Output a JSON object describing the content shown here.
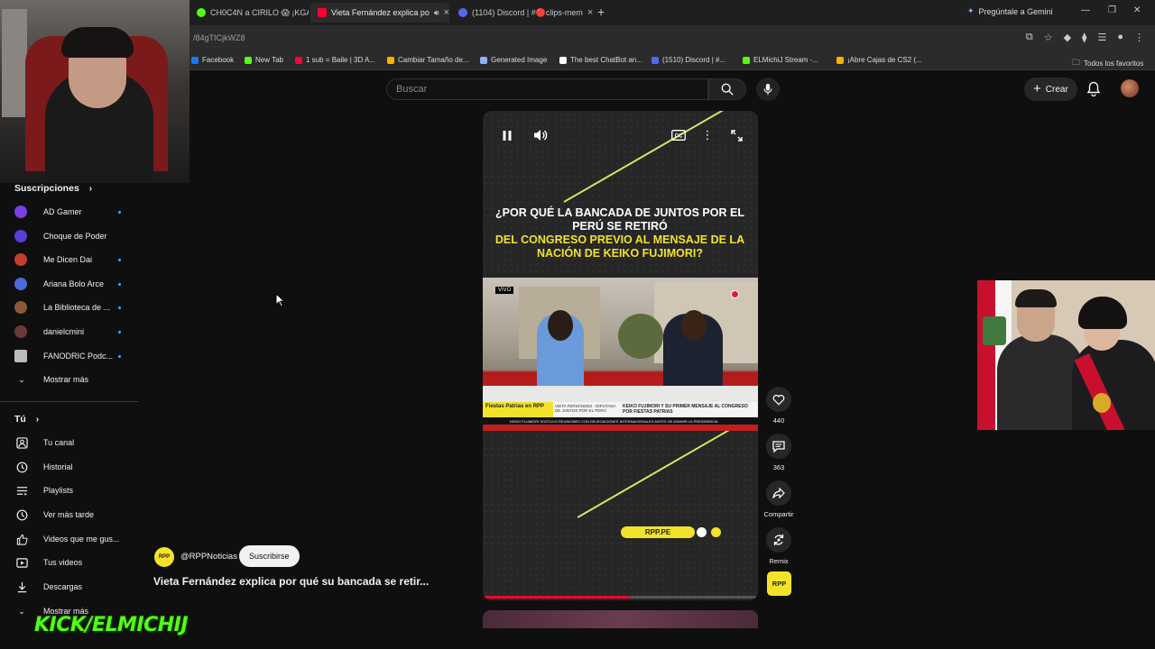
{
  "browser": {
    "tabs": [
      {
        "label": "CH0C4N a CIRILO 😱 ¡KGAI",
        "color": "#53fc18"
      },
      {
        "label": "Vieta Fernández explica po",
        "color": "#ff0033"
      },
      {
        "label": "(1104) Discord | #🔴clips-mem",
        "color": "#5865f2"
      }
    ],
    "gemini_label": "Pregúntale a Gemini",
    "url": "/84gTICjkWZ8",
    "bookmarks": [
      {
        "label": "Facebook",
        "color": "#1877f2"
      },
      {
        "label": "New Tab",
        "color": "#53fc18"
      },
      {
        "label": "1 sub = Baile | 3D A...",
        "color": "#ff0033"
      },
      {
        "label": "Cambiar Tamaño de...",
        "color": "#f4b400"
      },
      {
        "label": "Generated Image",
        "color": "#8ab4f8"
      },
      {
        "label": "The best ChatBot an...",
        "color": "#ffffff"
      },
      {
        "label": "(1510) Discord | #...",
        "color": "#5865f2"
      },
      {
        "label": "ELMichiJ Stream -...",
        "color": "#53fc18"
      },
      {
        "label": "¡Abre Cajas de CS2 (...",
        "color": "#f4b400"
      }
    ],
    "all_bookmarks": "Todos los favoritos"
  },
  "header": {
    "search_placeholder": "Buscar",
    "create_label": "Crear"
  },
  "sidebar": {
    "subscriptions_title": "Suscripciones",
    "subscriptions": [
      {
        "name": "AD Gamer",
        "color": "#7b3fe4",
        "dot": true
      },
      {
        "name": "Choque de Poder",
        "color": "#5a3fd4",
        "dot": false
      },
      {
        "name": "Me Dicen Dai",
        "color": "#c43d2a",
        "dot": true
      },
      {
        "name": "Ariana Bolo Arce",
        "color": "#4a6ad9",
        "dot": true
      },
      {
        "name": "La Biblioteca de ...",
        "color": "#8a5a3a",
        "dot": true
      },
      {
        "name": "danielcmini",
        "color": "#6a3a3a",
        "dot": true
      },
      {
        "name": "FANODRIC Podc...",
        "color": "#bbbbbb",
        "dot": true
      }
    ],
    "show_more": "Mostrar más",
    "you_title": "Tú",
    "you_items": [
      {
        "label": "Tu canal",
        "icon": "channel-icon"
      },
      {
        "label": "Historial",
        "icon": "history-icon"
      },
      {
        "label": "Playlists",
        "icon": "playlists-icon"
      },
      {
        "label": "Ver más tarde",
        "icon": "watch-later-icon"
      },
      {
        "label": "Videos que me gus...",
        "icon": "liked-icon"
      },
      {
        "label": "Tus videos",
        "icon": "your-videos-icon"
      },
      {
        "label": "Descargas",
        "icon": "downloads-icon"
      },
      {
        "label": "Mostrar más",
        "icon": "chevron-down-icon"
      }
    ]
  },
  "overlay": {
    "kick_text": "KICK/ELMICHIJ"
  },
  "short": {
    "headline_white": "¿Por qué la bancada de Juntos por el Perú se retiró",
    "headline_yellow": "del Congreso previo al mensaje de la Nación de Keiko Fujimori?",
    "live_tag": "VIVO",
    "lower_third": {
      "program": "Fiestas Patrias en RPP",
      "guest": "VIETA FERNÁNDEZ · DIPUTADA DE JUNTOS POR EL PERÚ",
      "headline": "KEIKO FUJIMORI Y SU PRIMER MENSAJE AL CONGRESO POR FIESTAS PATRIAS",
      "ticker": "KEIKO FUJIMORI SOSTUVO REUNIONES CON DELEGACIONES INTERNACIONALES ANTES DE ASUMIR LA PRESIDENCIA"
    },
    "brand_pill": "RPP.PE",
    "progress": 0.53,
    "likes": "440",
    "comments": "363",
    "share_label": "Compartir",
    "remix_label": "Remix",
    "rpp_logo": "RPP",
    "channel_handle": "@RPPNoticias",
    "channel_avatar": "RPP",
    "subscribe_label": "Suscribirse",
    "title": "Vieta Fernández explica por qué su bancada se retir..."
  }
}
